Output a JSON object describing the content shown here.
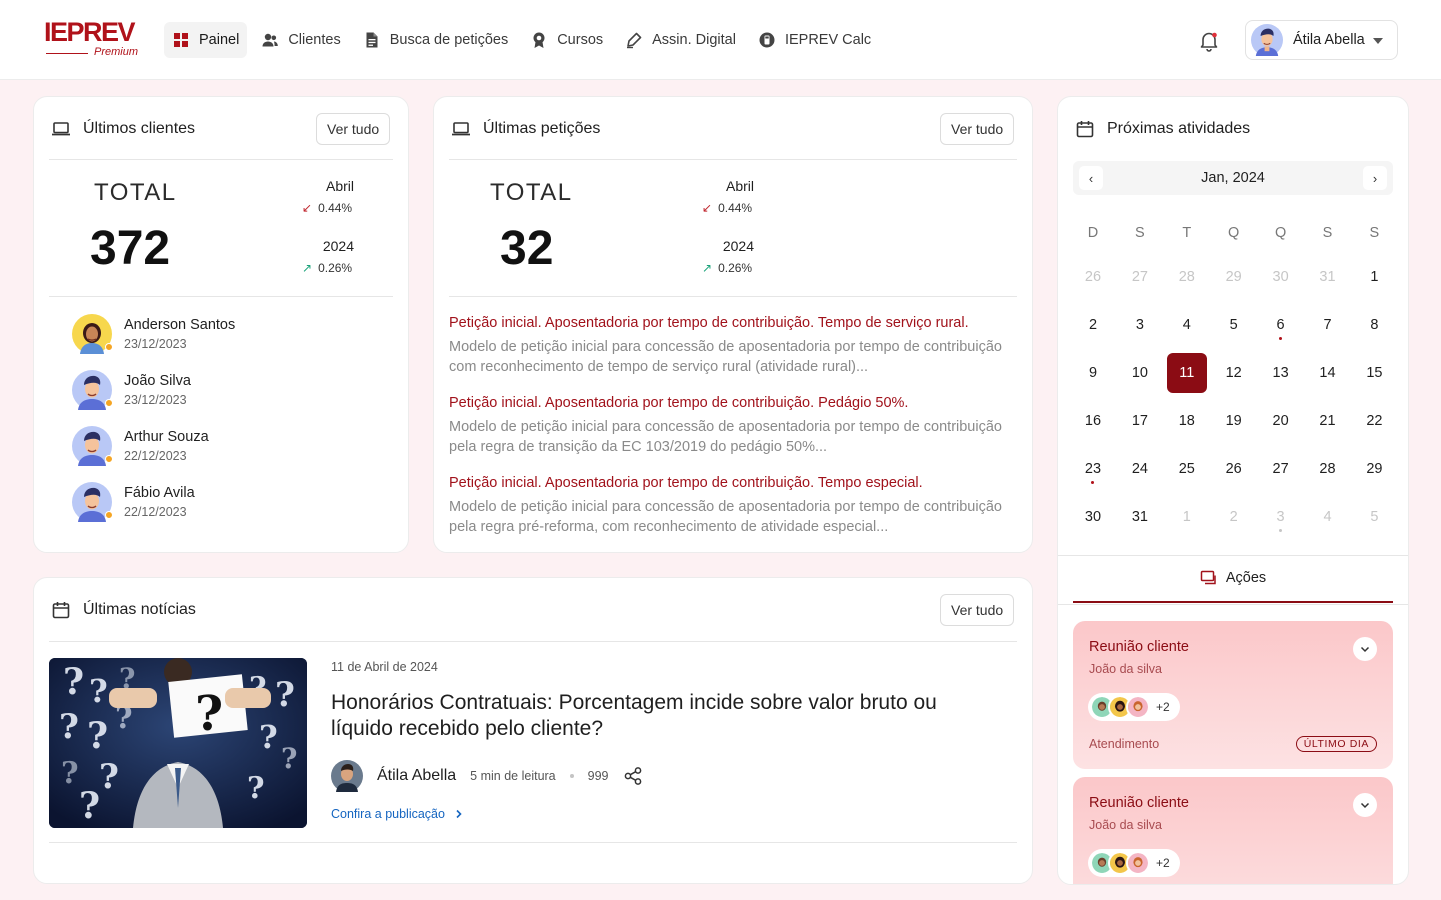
{
  "header": {
    "brand": "IEPREV",
    "brand_sub": "Premium",
    "nav": [
      {
        "label": "Painel",
        "icon": "grid-icon"
      },
      {
        "label": "Clientes",
        "icon": "users-icon"
      },
      {
        "label": "Busca de petições",
        "icon": "document-icon"
      },
      {
        "label": "Cursos",
        "icon": "award-icon"
      },
      {
        "label": "Assin. Digital",
        "icon": "pen-icon"
      },
      {
        "label": "IEPREV Calc",
        "icon": "calculator-icon"
      }
    ],
    "user_name": "Átila Abella"
  },
  "clients": {
    "title": "Últimos clientes",
    "see_all": "Ver tudo",
    "total_label": "TOTAL",
    "total": "372",
    "month_label": "Abril",
    "month_change": "0.44%",
    "year_label": "2024",
    "year_change": "0.26%",
    "items": [
      {
        "name": "Anderson Santos",
        "date": "23/12/2023"
      },
      {
        "name": "João Silva",
        "date": "23/12/2023"
      },
      {
        "name": "Arthur Souza",
        "date": "22/12/2023"
      },
      {
        "name": "Fábio Avila",
        "date": "22/12/2023"
      }
    ]
  },
  "petitions": {
    "title": "Últimas petições",
    "see_all": "Ver tudo",
    "total_label": "TOTAL",
    "total": "32",
    "month_label": "Abril",
    "month_change": "0.44%",
    "year_label": "2024",
    "year_change": "0.26%",
    "items": [
      {
        "title": "Petição inicial. Aposentadoria por tempo de contribuição. Tempo de serviço rural.",
        "desc": "Modelo de petição inicial para concessão de aposentadoria por tempo de contribuição com reconhecimento de tempo de serviço rural (atividade rural)..."
      },
      {
        "title": "Petição inicial. Aposentadoria por tempo de contribuição. Pedágio 50%.",
        "desc": "Modelo de petição inicial para concessão de aposentadoria por tempo de contribuição pela regra de transição da EC 103/2019 do pedágio 50%..."
      },
      {
        "title": "Petição inicial. Aposentadoria por tempo de contribuição. Tempo especial.",
        "desc": "Modelo de petição inicial para concessão de aposentadoria por tempo de contribuição pela regra pré-reforma, com reconhecimento de atividade especial..."
      }
    ]
  },
  "activities": {
    "title": "Próximas atividades",
    "month": "Jan, 2024",
    "weekdays": [
      "D",
      "S",
      "T",
      "Q",
      "Q",
      "S",
      "S"
    ],
    "days": [
      {
        "d": "26",
        "muted": true
      },
      {
        "d": "27",
        "muted": true
      },
      {
        "d": "28",
        "muted": true
      },
      {
        "d": "29",
        "muted": true
      },
      {
        "d": "30",
        "muted": true
      },
      {
        "d": "31",
        "muted": true
      },
      {
        "d": "1"
      },
      {
        "d": "2"
      },
      {
        "d": "3"
      },
      {
        "d": "4"
      },
      {
        "d": "5"
      },
      {
        "d": "6",
        "event": true
      },
      {
        "d": "7"
      },
      {
        "d": "8"
      },
      {
        "d": "9"
      },
      {
        "d": "10"
      },
      {
        "d": "11",
        "today": true
      },
      {
        "d": "12"
      },
      {
        "d": "13"
      },
      {
        "d": "14"
      },
      {
        "d": "15"
      },
      {
        "d": "16"
      },
      {
        "d": "17"
      },
      {
        "d": "18"
      },
      {
        "d": "19"
      },
      {
        "d": "20"
      },
      {
        "d": "21"
      },
      {
        "d": "22"
      },
      {
        "d": "23",
        "event": true
      },
      {
        "d": "24"
      },
      {
        "d": "25"
      },
      {
        "d": "26"
      },
      {
        "d": "27"
      },
      {
        "d": "28"
      },
      {
        "d": "29"
      },
      {
        "d": "30"
      },
      {
        "d": "31"
      },
      {
        "d": "1",
        "muted": true
      },
      {
        "d": "2",
        "muted": true
      },
      {
        "d": "3",
        "muted": true,
        "event": true
      },
      {
        "d": "4",
        "muted": true
      },
      {
        "d": "5",
        "muted": true
      }
    ],
    "tab_label": "Ações",
    "items": [
      {
        "title": "Reunião cliente",
        "client": "João da silva",
        "more": "+2",
        "type": "Atendimento",
        "badge": "ÚLTIMO DIA"
      },
      {
        "title": "Reunião cliente",
        "client": "João da silva",
        "more": "+2"
      }
    ]
  },
  "news": {
    "title": "Últimas notícias",
    "see_all": "Ver tudo",
    "date": "11 de Abril de 2024",
    "headline": "Honorários Contratuais: Porcentagem incide sobre valor bruto ou líquido recebido pelo cliente?",
    "author": "Átila Abella",
    "read_time": "5 min de leitura",
    "views": "999",
    "link": "Confira a publicação"
  },
  "colors": {
    "brand": "#b0121a",
    "accent_dark": "#8b0c14",
    "background": "#fdf1f3"
  }
}
